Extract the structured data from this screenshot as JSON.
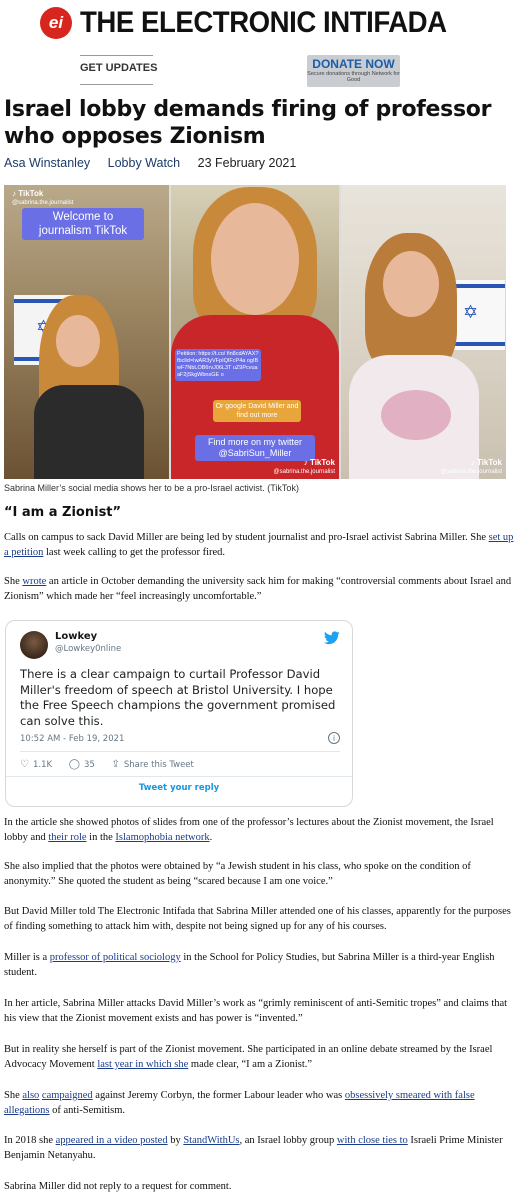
{
  "masthead": {
    "logo_mark": "ei",
    "site_name": "THE ELECTRONIC INTIFADA",
    "get_updates": "GET UPDATES",
    "donate_title": "DONATE NOW",
    "donate_sub": "Secure donations through Network for Good",
    "brand_color": "#d7261e"
  },
  "article": {
    "headline": "Israel lobby demands firing of professor who opposes Zionism",
    "author": "Asa Winstanley",
    "section": "Lobby Watch",
    "date": "23 February 2021"
  },
  "photo": {
    "caption": "Sabrina Miller’s social media shows her to be a pro-Israel activist. (TikTok)",
    "tiktok_label": "TikTok",
    "handle": "@sabrina.the.journalist",
    "bubble1": "Welcome to journalism TikTok",
    "bubble2": "Petition: https://t.co/ fin8cdAYAX? fbclid=IwAR3yVFpIQIFcP4a ogIBwF7NbLOB6rvJ06L3T uZ9PcvuaaF2jSkgWbnsGE o",
    "bubble3": "Or google David Miller and find out more",
    "bubble4": "Find more on my twitter @SabriSun_Miller"
  },
  "subhead": "“I am a Zionist”",
  "paragraphs": {
    "p1a": "Calls on campus to sack David Miller are being led by student journalist and pro-Israel activist Sabrina Miller. She ",
    "p1link": "set up a petition",
    "p1b": " last week calling to get the professor fired.",
    "p2a": "She ",
    "p2link": "wrote",
    "p2b": " an article in October demanding the university sack him for making “controversial comments about Israel and Zionism” which made her “feel increasingly uncomfortable.”",
    "p3a": "In the article she showed photos of slides from one of the professor’s lectures about the Zionist movement, the Israel lobby and ",
    "p3link1": "their role",
    "p3b": " in the ",
    "p3link2": "Islamophobia network",
    "p3c": ".",
    "p4": "She also implied that the photos were obtained by “a Jewish student in his class, who spoke on the condition of anonymity.” She quoted the student as being “scared because I am one voice.”",
    "p5": "But David Miller told The Electronic Intifada that Sabrina Miller attended one of his classes, apparently for the purposes of finding something to attack him with, despite not being signed up for any of his courses.",
    "p6a": "Miller is a ",
    "p6link": "professor of political sociology",
    "p6b": " in the School for Policy Studies, but Sabrina Miller is a third-year English student.",
    "p7": "In her article, Sabrina Miller attacks David Miller’s work as “grimly reminiscent of anti-Semitic tropes” and claims that his view that the Zionist movement exists and has power is “invented.”",
    "p8a": "But in reality she herself is part of the Zionist movement. She participated in an online debate streamed by the Israel Advocacy Movement ",
    "p8link": "last year in which she",
    "p8b": " made clear, “I am a Zionist.”",
    "p9a": "She ",
    "p9link1": "also",
    "p9b": " ",
    "p9link2": "campaigned",
    "p9c": " against Jeremy Corbyn, the former Labour leader who was ",
    "p9link3": "obsessively smeared with false allegations",
    "p9d": " of anti-Semitism.",
    "p10a": "In 2018 she ",
    "p10link1": "appeared in a video posted",
    "p10b": " by ",
    "p10link2": "StandWithUs",
    "p10c": ", an Israel lobby group ",
    "p10link3": "with close ties to",
    "p10d": " Israeli Prime Minister Benjamin Netanyahu.",
    "p11": "Sabrina Miller did not reply to a request for comment."
  },
  "tweet": {
    "name": "Lowkey",
    "handle": "@Lowkey0nline",
    "text": "There is a clear campaign to curtail Professor David Miller's freedom of speech at Bristol University. I hope the Free Speech champions the government promised can solve this.",
    "time": "10:52 AM - Feb 19, 2021",
    "likes": "1.1K",
    "replies": "35",
    "share": "Share this Tweet",
    "reply_cta": "Tweet your reply",
    "accent": "#1da1f2"
  }
}
